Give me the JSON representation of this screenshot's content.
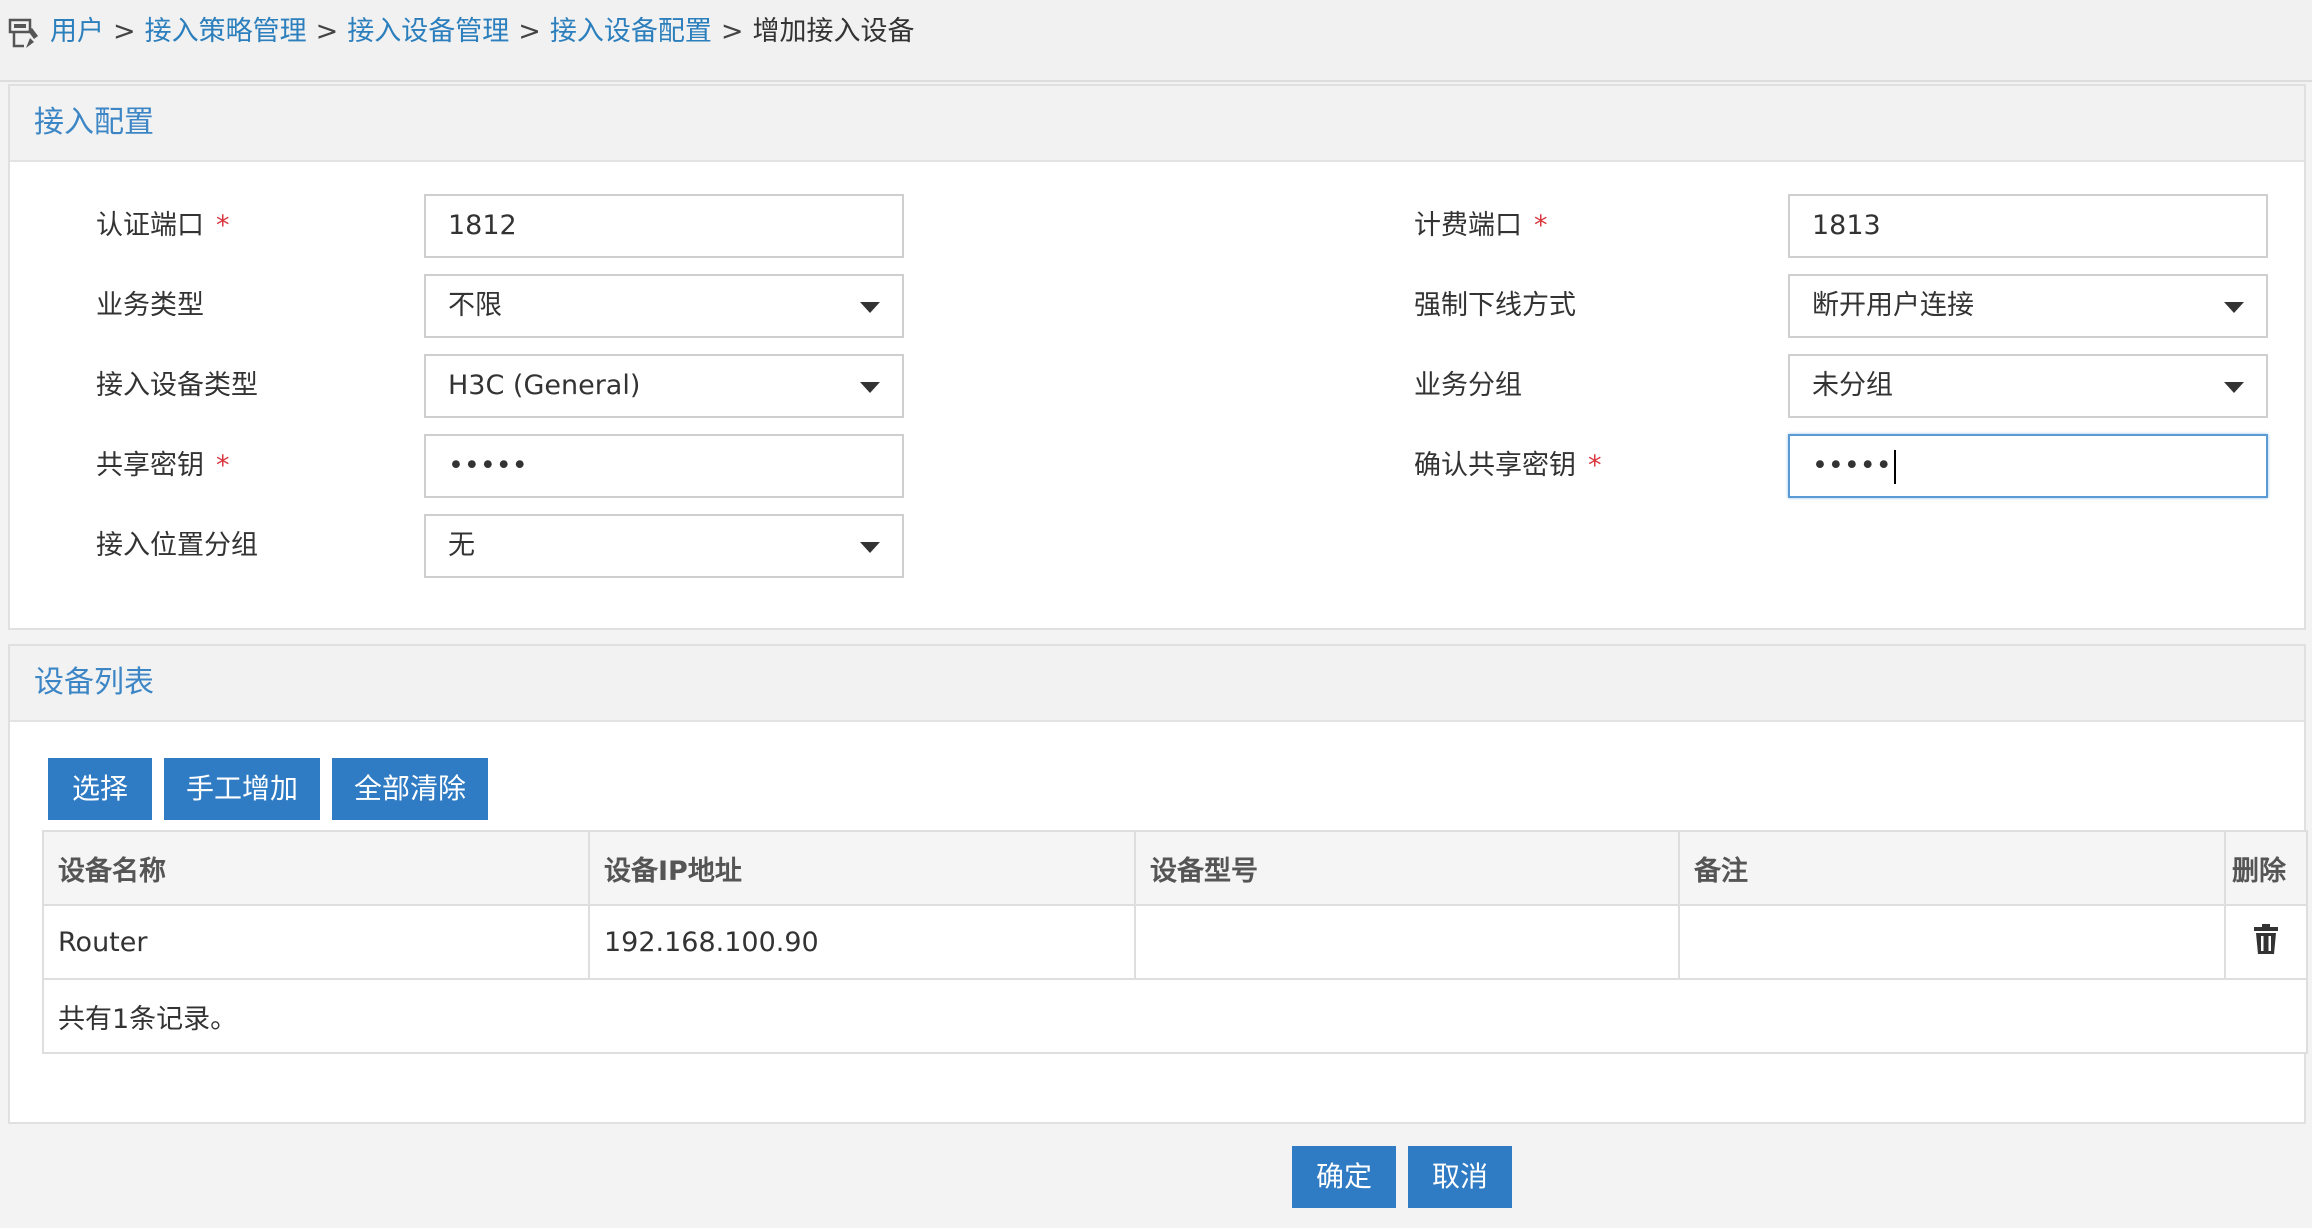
{
  "breadcrumb": {
    "items": [
      "用户",
      "接入策略管理",
      "接入设备管理",
      "接入设备配置"
    ],
    "current": "增加接入设备",
    "separator": ">"
  },
  "access_config": {
    "title": "接入配置",
    "auth_port": {
      "label": "认证端口",
      "value": "1812",
      "required": "*"
    },
    "acct_port": {
      "label": "计费端口",
      "value": "1813",
      "required": "*"
    },
    "service_type": {
      "label": "业务类型",
      "value": "不限"
    },
    "force_offline": {
      "label": "强制下线方式",
      "value": "断开用户连接"
    },
    "device_type": {
      "label": "接入设备类型",
      "value": "H3C (General)"
    },
    "service_group": {
      "label": "业务分组",
      "value": "未分组"
    },
    "shared_key": {
      "label": "共享密钥",
      "value": "•••••",
      "required": "*"
    },
    "confirm_key": {
      "label": "确认共享密钥",
      "value": "•••••",
      "required": "*"
    },
    "location_group": {
      "label": "接入位置分组",
      "value": "无"
    }
  },
  "device_list": {
    "title": "设备列表",
    "buttons": {
      "select": "选择",
      "manual_add": "手工增加",
      "clear_all": "全部清除"
    },
    "columns": [
      "设备名称",
      "设备IP地址",
      "设备型号",
      "备注",
      "删除"
    ],
    "rows": [
      {
        "name": "Router",
        "ip": "192.168.100.90",
        "model": "",
        "note": ""
      }
    ],
    "footer": "共有1条记录。"
  },
  "actions": {
    "ok": "确定",
    "cancel": "取消"
  },
  "colors": {
    "accent": "#2f7cc4",
    "link": "#2c7fbd",
    "required": "#d9363e"
  }
}
